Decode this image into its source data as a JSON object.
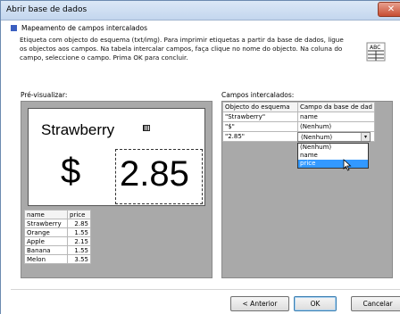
{
  "window": {
    "title": "Abrir base de dados",
    "close_symbol": "✕"
  },
  "header": {
    "heading": "Mapeamento de campos intercalados",
    "description": "Etiqueta com objecto do esquema (txt/img). Para imprimir etiquetas a partir da base de dados, ligue os objectos aos campos. Na tabela intercalar campos, faça clique no nome do objecto. Na coluna do campo, seleccione o campo. Prima OK para concluir.",
    "abc_icon_text": "ABC"
  },
  "preview": {
    "label": "Pré-visualizar:",
    "product_name": "Strawberry",
    "currency": "$",
    "price": "2.85",
    "table": {
      "headers": [
        "name",
        "price"
      ],
      "rows": [
        [
          "Strawberry",
          "2.85"
        ],
        [
          "Orange",
          "1.55"
        ],
        [
          "Apple",
          "2.15"
        ],
        [
          "Banana",
          "1.55"
        ],
        [
          "Melon",
          "3.55"
        ]
      ]
    }
  },
  "fields": {
    "label": "Campos intercalados:",
    "headers": [
      "Objecto do esquema",
      "Campo da base de dad"
    ],
    "rows": [
      [
        "\"Strawberry\"",
        "name"
      ],
      [
        "\"$\"",
        "(Nenhum)"
      ],
      [
        "\"2.85\"",
        "(Nenhum)"
      ]
    ],
    "dropdown": {
      "selected": "(Nenhum)",
      "arrow": "▾",
      "options": [
        "(Nenhum)",
        "name",
        "price"
      ],
      "highlighted": "price"
    }
  },
  "buttons": {
    "prev": "< Anterior",
    "ok": "OK",
    "cancel": "Cancelar"
  },
  "colors": {
    "accent": "#3b5fc0",
    "selection": "#3399ff"
  }
}
